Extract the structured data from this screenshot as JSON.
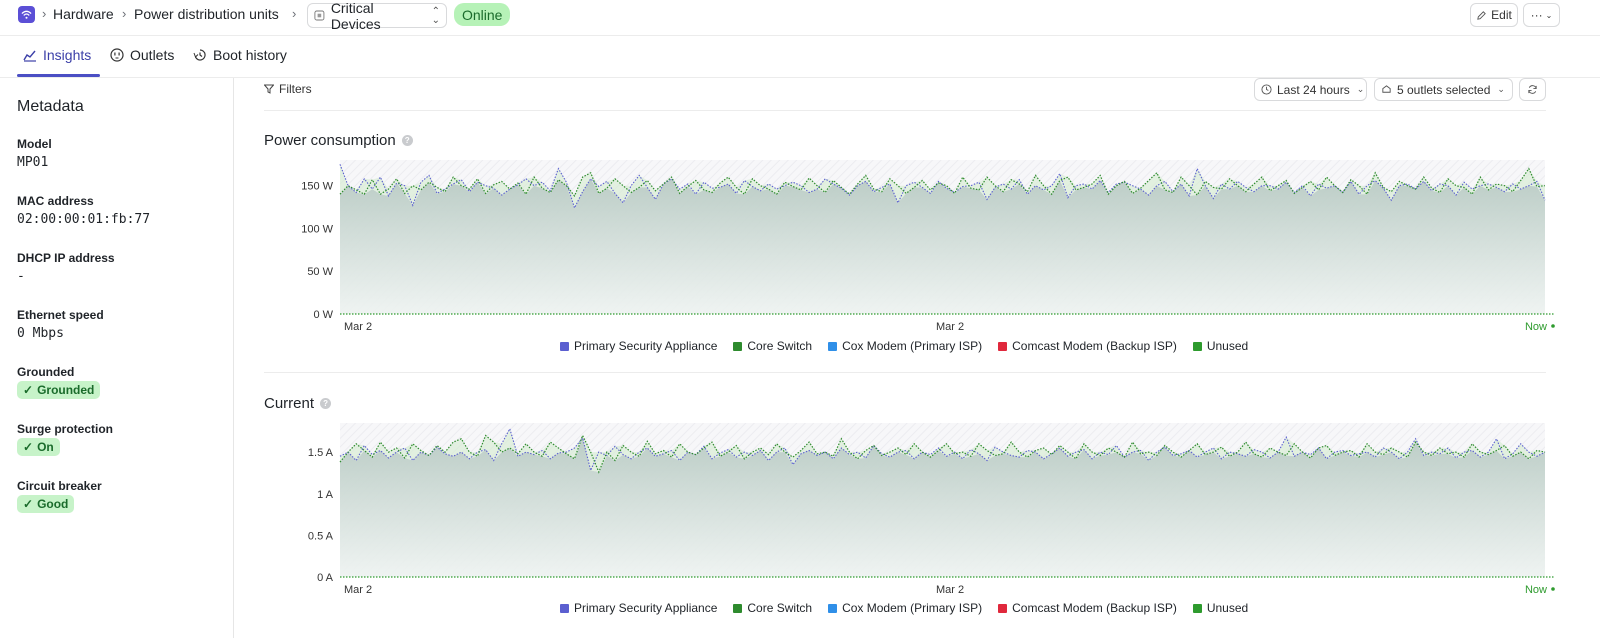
{
  "breadcrumb": {
    "items": [
      "Hardware",
      "Power distribution units"
    ],
    "device": "Critical Devices",
    "status": "Online"
  },
  "actions": {
    "edit": "Edit"
  },
  "tabs": [
    {
      "label": "Insights",
      "icon": "chart-icon",
      "active": true
    },
    {
      "label": "Outlets",
      "icon": "outlet-icon",
      "active": false
    },
    {
      "label": "Boot history",
      "icon": "boot-history-icon",
      "active": false
    }
  ],
  "metadata": {
    "title": "Metadata",
    "fields": [
      {
        "label": "Model",
        "value": "MP01",
        "kind": "text"
      },
      {
        "label": "MAC address",
        "value": "02:00:00:01:fb:77",
        "kind": "text"
      },
      {
        "label": "DHCP IP address",
        "value": "-",
        "kind": "text"
      },
      {
        "label": "Ethernet speed",
        "value": "0 Mbps",
        "kind": "text"
      },
      {
        "label": "Grounded",
        "value": "Grounded",
        "kind": "pill"
      },
      {
        "label": "Surge protection",
        "value": "On",
        "kind": "pill"
      },
      {
        "label": "Circuit breaker",
        "value": "Good",
        "kind": "pill"
      }
    ]
  },
  "filters": {
    "label": "Filters",
    "range": "Last 24 hours",
    "outlets": "5 outlets selected"
  },
  "colors": {
    "accent": "#4b4fc4",
    "online_bg": "#b6f2b7",
    "primary_security_appliance": "#5b5fd0",
    "core_switch": "#2e8b2e",
    "cox_modem": "#2f8fe8",
    "comcast_modem": "#e0283c",
    "unused": "#2e9b2e"
  },
  "chart_data": [
    {
      "type": "area",
      "title": "Power consumption",
      "y_unit": "W",
      "ylim": [
        0,
        180
      ],
      "y_ticks": [
        "0 W",
        "50 W",
        "100 W",
        "150 W"
      ],
      "x_ticks": [
        "Mar 2",
        "Mar 2",
        "Now"
      ],
      "legend": [
        "Primary Security Appliance",
        "Core Switch",
        "Cox Modem (Primary ISP)",
        "Comcast Modem (Backup ISP)",
        "Unused"
      ],
      "series": [
        {
          "name": "Primary Security Appliance",
          "values": [
            175,
            150,
            142,
            158,
            146,
            160,
            138,
            153,
            150,
            127,
            154,
            162,
            141,
            146,
            152,
            157,
            143,
            154,
            150,
            147,
            139,
            146,
            151,
            158,
            150,
            154,
            144,
            170,
            154,
            124,
            143,
            158,
            149,
            155,
            141,
            130,
            150,
            162,
            148,
            134,
            152,
            158,
            146,
            152,
            140,
            154,
            147,
            148,
            152,
            141,
            156,
            149,
            144,
            152,
            146,
            150,
            154,
            150,
            142,
            146,
            158,
            152,
            147,
            139,
            150,
            155,
            143,
            148,
            152,
            130,
            150,
            154,
            148,
            141,
            155,
            147,
            142,
            149,
            150,
            154,
            134,
            148,
            152,
            146,
            157,
            140,
            150,
            145,
            150,
            164,
            136,
            150,
            152,
            146,
            156,
            142,
            152,
            154,
            150,
            146,
            139,
            150,
            155,
            143,
            152,
            138,
            170,
            150,
            135,
            152,
            146,
            155,
            148,
            143,
            150,
            150,
            146,
            154,
            142,
            150,
            138,
            152,
            147,
            150,
            142,
            155,
            140,
            150,
            156,
            147,
            133,
            150,
            152,
            146,
            155,
            144,
            152,
            150,
            139,
            154,
            146,
            150,
            152,
            148,
            143,
            152,
            146,
            150,
            155,
            133
          ]
        },
        {
          "name": "Core Switch",
          "values": [
            140,
            150,
            145,
            140,
            157,
            140,
            146,
            158,
            141,
            150,
            145,
            154,
            148,
            143,
            160,
            150,
            146,
            158,
            141,
            151,
            155,
            146,
            153,
            140,
            160,
            147,
            142,
            157,
            150,
            138,
            160,
            165,
            141,
            147,
            158,
            150,
            142,
            148,
            156,
            144,
            152,
            160,
            141,
            149,
            156,
            145,
            142,
            153,
            160,
            148,
            140,
            158,
            150,
            146,
            140,
            154,
            149,
            145,
            159,
            150,
            142,
            156,
            148,
            140,
            152,
            162,
            146,
            143,
            158,
            150,
            141,
            148,
            156,
            145,
            153,
            150,
            141,
            160,
            147,
            145,
            160,
            150,
            143,
            157,
            152,
            143,
            162,
            150,
            140,
            156,
            160,
            145,
            148,
            152,
            162,
            140,
            150,
            155,
            141,
            147,
            156,
            165,
            145,
            142,
            160,
            150,
            139,
            155,
            148,
            146,
            158,
            150,
            143,
            152,
            160,
            144,
            150,
            156,
            141,
            148,
            155,
            145,
            160,
            150,
            142,
            157,
            150,
            140,
            165,
            148,
            143,
            155,
            150,
            146,
            160,
            147,
            142,
            158,
            150,
            148,
            140,
            160,
            145,
            152,
            150,
            143,
            156,
            170,
            149,
            150
          ]
        },
        {
          "name": "Cox Modem (Primary ISP)",
          "values": []
        },
        {
          "name": "Comcast Modem (Backup ISP)",
          "values": []
        },
        {
          "name": "Unused",
          "values": []
        }
      ]
    },
    {
      "type": "area",
      "title": "Current",
      "y_unit": "A",
      "ylim": [
        0,
        1.85
      ],
      "y_ticks": [
        "0 A",
        "0.5 A",
        "1 A",
        "1.5 A"
      ],
      "x_ticks": [
        "Mar 2",
        "Mar 2",
        "Now"
      ],
      "legend": [
        "Primary Security Appliance",
        "Core Switch",
        "Cox Modem (Primary ISP)",
        "Comcast Modem (Backup ISP)",
        "Unused"
      ],
      "series": [
        {
          "name": "Primary Security Appliance",
          "values": [
            1.45,
            1.5,
            1.4,
            1.58,
            1.47,
            1.52,
            1.43,
            1.5,
            1.55,
            1.4,
            1.5,
            1.46,
            1.56,
            1.48,
            1.45,
            1.5,
            1.42,
            1.5,
            1.53,
            1.4,
            1.6,
            1.78,
            1.45,
            1.5,
            1.47,
            1.52,
            1.42,
            1.49,
            1.5,
            1.55,
            1.67,
            1.28,
            1.5,
            1.46,
            1.57,
            1.47,
            1.42,
            1.5,
            1.55,
            1.45,
            1.48,
            1.52,
            1.4,
            1.5,
            1.47,
            1.57,
            1.42,
            1.49,
            1.53,
            1.44,
            1.5,
            1.46,
            1.52,
            1.4,
            1.5,
            1.55,
            1.35,
            1.48,
            1.52,
            1.46,
            1.5,
            1.42,
            1.55,
            1.47,
            1.5,
            1.43,
            1.58,
            1.48,
            1.44,
            1.5,
            1.52,
            1.42,
            1.5,
            1.47,
            1.55,
            1.45,
            1.5,
            1.42,
            1.53,
            1.48,
            1.4,
            1.56,
            1.5,
            1.46,
            1.44,
            1.52,
            1.5,
            1.42,
            1.48,
            1.55,
            1.45,
            1.5,
            1.53,
            1.42,
            1.5,
            1.47,
            1.58,
            1.44,
            1.5,
            1.52,
            1.4,
            1.5,
            1.56,
            1.46,
            1.48,
            1.52,
            1.44,
            1.5,
            1.55,
            1.42,
            1.5,
            1.48,
            1.45,
            1.53,
            1.5,
            1.43,
            1.5,
            1.68,
            1.45,
            1.5,
            1.47,
            1.55,
            1.42,
            1.5,
            1.52,
            1.46,
            1.48,
            1.5,
            1.44,
            1.55,
            1.5,
            1.42,
            1.5,
            1.66,
            1.46,
            1.5,
            1.48,
            1.55,
            1.43,
            1.5,
            1.52,
            1.44,
            1.5,
            1.66,
            1.42,
            1.48,
            1.6,
            1.5,
            1.45,
            1.5
          ]
        },
        {
          "name": "Core Switch",
          "values": [
            1.38,
            1.5,
            1.6,
            1.52,
            1.44,
            1.62,
            1.5,
            1.55,
            1.43,
            1.6,
            1.52,
            1.46,
            1.58,
            1.5,
            1.62,
            1.66,
            1.5,
            1.45,
            1.7,
            1.62,
            1.5,
            1.55,
            1.48,
            1.6,
            1.5,
            1.45,
            1.62,
            1.55,
            1.48,
            1.42,
            1.7,
            1.5,
            1.26,
            1.5,
            1.4,
            1.58,
            1.5,
            1.45,
            1.63,
            1.48,
            1.52,
            1.44,
            1.6,
            1.5,
            1.47,
            1.55,
            1.62,
            1.45,
            1.5,
            1.58,
            1.42,
            1.5,
            1.55,
            1.47,
            1.6,
            1.5,
            1.44,
            1.52,
            1.62,
            1.48,
            1.5,
            1.45,
            1.66,
            1.5,
            1.42,
            1.52,
            1.58,
            1.46,
            1.5,
            1.55,
            1.47,
            1.6,
            1.5,
            1.44,
            1.52,
            1.6,
            1.48,
            1.5,
            1.45,
            1.6,
            1.52,
            1.46,
            1.48,
            1.62,
            1.5,
            1.44,
            1.52,
            1.55,
            1.47,
            1.58,
            1.5,
            1.42,
            1.6,
            1.5,
            1.46,
            1.55,
            1.5,
            1.44,
            1.62,
            1.48,
            1.5,
            1.46,
            1.58,
            1.5,
            1.44,
            1.52,
            1.6,
            1.47,
            1.5,
            1.56,
            1.45,
            1.5,
            1.62,
            1.48,
            1.44,
            1.55,
            1.5,
            1.46,
            1.6,
            1.5,
            1.43,
            1.55,
            1.58,
            1.46,
            1.5,
            1.52,
            1.44,
            1.6,
            1.5,
            1.47,
            1.55,
            1.5,
            1.44,
            1.62,
            1.5,
            1.46,
            1.55,
            1.48,
            1.5,
            1.44,
            1.6,
            1.5,
            1.47,
            1.52,
            1.58,
            1.45,
            1.5,
            1.42,
            1.52,
            1.5
          ]
        },
        {
          "name": "Cox Modem (Primary ISP)",
          "values": []
        },
        {
          "name": "Comcast Modem (Backup ISP)",
          "values": []
        },
        {
          "name": "Unused",
          "values": []
        }
      ]
    }
  ]
}
